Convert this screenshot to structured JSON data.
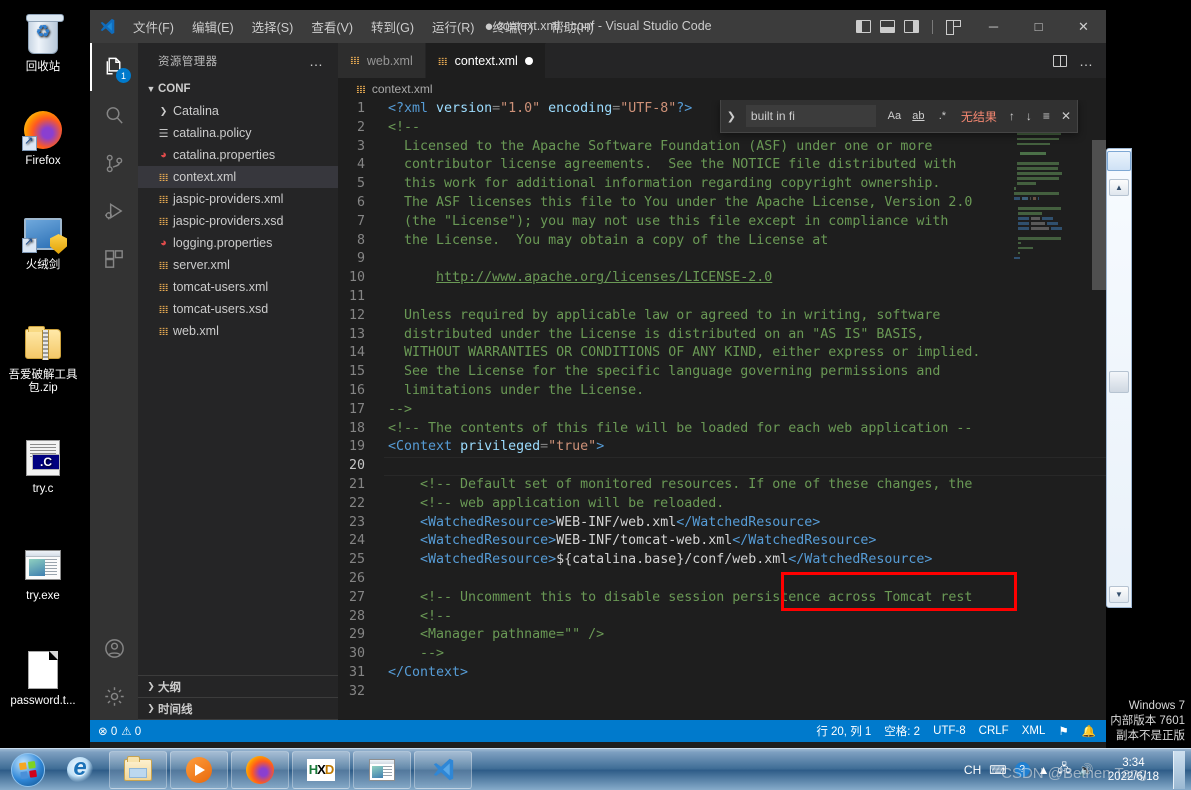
{
  "desktop": {
    "icons": [
      {
        "name": "recycle-bin",
        "label": "回收站",
        "glyph": "trash"
      },
      {
        "name": "firefox",
        "label": "Firefox",
        "glyph": "firefox"
      },
      {
        "name": "huorongjian",
        "label": "火绒剑",
        "glyph": "shield"
      },
      {
        "name": "wuaipojie-zip",
        "label": "吾爱破解工具包.zip",
        "glyph": "zip"
      },
      {
        "name": "try-c",
        "label": "try.c",
        "glyph": "csource"
      },
      {
        "name": "try-exe",
        "label": "try.exe",
        "glyph": "exe"
      },
      {
        "name": "password-txt",
        "label": "password.t... ",
        "glyph": "textfile"
      }
    ]
  },
  "vscode": {
    "titlebar": {
      "menus": [
        "文件(F)",
        "编辑(E)",
        "选择(S)",
        "查看(V)",
        "转到(G)",
        "运行(R)",
        "终端(T)",
        "帮助(H)"
      ],
      "dirty_marker": "●",
      "title": "context.xml - conf - Visual Studio Code",
      "window_controls": {
        "minimize": "─",
        "maximize": "□",
        "close": "✕"
      }
    },
    "activitybar": [
      {
        "name": "explorer",
        "icon": "files-icon",
        "badge": "1",
        "active": true
      },
      {
        "name": "search",
        "icon": "search-icon",
        "badge": "",
        "active": false
      },
      {
        "name": "source-control",
        "icon": "source-control-icon",
        "badge": "",
        "active": false
      },
      {
        "name": "run-debug",
        "icon": "run-and-debug-icon",
        "badge": "",
        "active": false
      },
      {
        "name": "extensions",
        "icon": "extensions-icon",
        "badge": "",
        "active": false
      },
      {
        "name": "accounts",
        "icon": "account-icon",
        "badge": "",
        "active": false
      },
      {
        "name": "manage",
        "icon": "gear-icon",
        "badge": "",
        "active": false
      }
    ],
    "sidebar": {
      "header": "资源管理器",
      "more": "…",
      "folder": "CONF",
      "files": [
        {
          "label": "Catalina",
          "icon": "folder",
          "selected": false
        },
        {
          "label": "catalina.policy",
          "icon": "policy",
          "selected": false
        },
        {
          "label": "catalina.properties",
          "icon": "properties",
          "selected": false
        },
        {
          "label": "context.xml",
          "icon": "xml",
          "selected": true
        },
        {
          "label": "jaspic-providers.xml",
          "icon": "xml",
          "selected": false
        },
        {
          "label": "jaspic-providers.xsd",
          "icon": "xml",
          "selected": false
        },
        {
          "label": "logging.properties",
          "icon": "properties",
          "selected": false
        },
        {
          "label": "server.xml",
          "icon": "xml",
          "selected": false
        },
        {
          "label": "tomcat-users.xml",
          "icon": "xml",
          "selected": false
        },
        {
          "label": "tomcat-users.xsd",
          "icon": "xml",
          "selected": false
        },
        {
          "label": "web.xml",
          "icon": "xml",
          "selected": false
        }
      ],
      "bottom_sections": [
        "大纲",
        "时间线"
      ]
    },
    "tabs": [
      {
        "label": "web.xml",
        "active": false,
        "dirty": false
      },
      {
        "label": "context.xml",
        "active": true,
        "dirty": true
      }
    ],
    "breadcrumb": "context.xml",
    "find": {
      "value": "built in fi",
      "match_case": "Aa",
      "whole_word": "ab",
      "regex": ".*",
      "result": "无结果",
      "prev": "↑",
      "next": "↓",
      "find_in_selection": "≡",
      "close": "✕"
    },
    "statusbar": {
      "left": [
        "⊗ 0",
        "⚠ 0"
      ],
      "position": "行 20, 列 1",
      "indent": "空格: 2",
      "encoding": "UTF-8",
      "eol": "CRLF",
      "language": "XML",
      "feedback": "⚑",
      "bell": "ὑ4"
    },
    "editor": {
      "total_lines": 32,
      "current_line": 20,
      "lines": [
        {
          "n": 1,
          "tokens": [
            {
              "t": "<?xml ",
              "c": "c-tag"
            },
            {
              "t": "version",
              "c": "c-attr"
            },
            {
              "t": "=",
              "c": "c-punc"
            },
            {
              "t": "\"1.0\"",
              "c": "c-str"
            },
            {
              "t": " ",
              "c": "c-white"
            },
            {
              "t": "encoding",
              "c": "c-attr"
            },
            {
              "t": "=",
              "c": "c-punc"
            },
            {
              "t": "\"UTF-8\"",
              "c": "c-str"
            },
            {
              "t": "?>",
              "c": "c-tag"
            }
          ]
        },
        {
          "n": 2,
          "tokens": [
            {
              "t": "<!--",
              "c": "c-com"
            }
          ]
        },
        {
          "n": 3,
          "tokens": [
            {
              "t": "  Licensed to the Apache Software Foundation (ASF) under one or more",
              "c": "c-com"
            }
          ]
        },
        {
          "n": 4,
          "tokens": [
            {
              "t": "  contributor license agreements.  See the NOTICE file distributed with",
              "c": "c-com"
            }
          ]
        },
        {
          "n": 5,
          "tokens": [
            {
              "t": "  this work for additional information regarding copyright ownership.",
              "c": "c-com"
            }
          ]
        },
        {
          "n": 6,
          "tokens": [
            {
              "t": "  The ASF licenses this file to You under the Apache License, Version 2.0",
              "c": "c-com"
            }
          ]
        },
        {
          "n": 7,
          "tokens": [
            {
              "t": "  (the \"License\"); you may not use this file except in compliance with",
              "c": "c-com"
            }
          ]
        },
        {
          "n": 8,
          "tokens": [
            {
              "t": "  the License.  You may obtain a copy of the License at",
              "c": "c-com"
            }
          ]
        },
        {
          "n": 9,
          "tokens": [
            {
              "t": "",
              "c": "c-com"
            }
          ]
        },
        {
          "n": 10,
          "tokens": [
            {
              "t": "      ",
              "c": "c-com"
            },
            {
              "t": "http://www.apache.org/licenses/LICENSE-2.0",
              "c": "c-link"
            }
          ]
        },
        {
          "n": 11,
          "tokens": [
            {
              "t": "",
              "c": "c-com"
            }
          ]
        },
        {
          "n": 12,
          "tokens": [
            {
              "t": "  Unless required by applicable law or agreed to in writing, software",
              "c": "c-com"
            }
          ]
        },
        {
          "n": 13,
          "tokens": [
            {
              "t": "  distributed under the License is distributed on an \"AS IS\" BASIS,",
              "c": "c-com"
            }
          ]
        },
        {
          "n": 14,
          "tokens": [
            {
              "t": "  WITHOUT WARRANTIES OR CONDITIONS OF ANY KIND, either express or implied.",
              "c": "c-com"
            }
          ]
        },
        {
          "n": 15,
          "tokens": [
            {
              "t": "  See the License for the specific language governing permissions and",
              "c": "c-com"
            }
          ]
        },
        {
          "n": 16,
          "tokens": [
            {
              "t": "  limitations under the License.",
              "c": "c-com"
            }
          ]
        },
        {
          "n": 17,
          "tokens": [
            {
              "t": "-->",
              "c": "c-com"
            }
          ]
        },
        {
          "n": 18,
          "tokens": [
            {
              "t": "<!-- The contents of this file will be loaded for each web application --",
              "c": "c-com"
            }
          ]
        },
        {
          "n": 19,
          "tokens": [
            {
              "t": "<Context ",
              "c": "c-tag"
            },
            {
              "t": "privileged",
              "c": "c-attr"
            },
            {
              "t": "=",
              "c": "c-punc"
            },
            {
              "t": "\"true\"",
              "c": "c-str"
            },
            {
              "t": ">",
              "c": "c-tag"
            }
          ]
        },
        {
          "n": 20,
          "tokens": [
            {
              "t": "",
              "c": "c-white"
            }
          ]
        },
        {
          "n": 21,
          "tokens": [
            {
              "t": "    <!-- Default set of monitored resources. If one of these changes, the",
              "c": "c-com"
            }
          ]
        },
        {
          "n": 22,
          "tokens": [
            {
              "t": "    <!-- web application will be reloaded.",
              "c": "c-com"
            }
          ]
        },
        {
          "n": 23,
          "tokens": [
            {
              "t": "    <WatchedResource>",
              "c": "c-tag"
            },
            {
              "t": "WEB-INF/web.xml",
              "c": "c-white"
            },
            {
              "t": "</WatchedResource>",
              "c": "c-tag"
            }
          ]
        },
        {
          "n": 24,
          "tokens": [
            {
              "t": "    <WatchedResource>",
              "c": "c-tag"
            },
            {
              "t": "WEB-INF/tomcat-web.xml",
              "c": "c-white"
            },
            {
              "t": "</WatchedResource>",
              "c": "c-tag"
            }
          ]
        },
        {
          "n": 25,
          "tokens": [
            {
              "t": "    <WatchedResource>",
              "c": "c-tag"
            },
            {
              "t": "${catalina.base}/conf/web.xml",
              "c": "c-white"
            },
            {
              "t": "</WatchedResource>",
              "c": "c-tag"
            }
          ]
        },
        {
          "n": 26,
          "tokens": [
            {
              "t": "",
              "c": "c-white"
            }
          ]
        },
        {
          "n": 27,
          "tokens": [
            {
              "t": "    <!-- Uncomment this to disable session persistence across Tomcat rest",
              "c": "c-com"
            }
          ]
        },
        {
          "n": 28,
          "tokens": [
            {
              "t": "    <!--",
              "c": "c-com"
            }
          ]
        },
        {
          "n": 29,
          "tokens": [
            {
              "t": "    <Manager pathname=\"\" />",
              "c": "c-com"
            }
          ]
        },
        {
          "n": 30,
          "tokens": [
            {
              "t": "    -->",
              "c": "c-com"
            }
          ]
        },
        {
          "n": 31,
          "tokens": [
            {
              "t": "</Context>",
              "c": "c-tag"
            }
          ]
        },
        {
          "n": 32,
          "tokens": [
            {
              "t": "",
              "c": "c-white"
            }
          ]
        }
      ]
    },
    "annotation": {
      "name": "red-highlight-box",
      "color": "#ff0000"
    }
  },
  "watermark": {
    "line1": "Windows 7",
    "line2": "内部版本 7601",
    "line3": "副本不是正版"
  },
  "taskbar": {
    "start": "start-orb",
    "buttons": [
      {
        "name": "internet-explorer",
        "glyph": "ie"
      },
      {
        "name": "windows-explorer",
        "glyph": "folder"
      },
      {
        "name": "windows-media-player",
        "glyph": "wmp"
      },
      {
        "name": "firefox",
        "glyph": "firefox"
      },
      {
        "name": "hxd-hex-editor",
        "glyph": "hxd"
      },
      {
        "name": "application",
        "glyph": "app"
      },
      {
        "name": "visual-studio-code",
        "glyph": "vscode"
      }
    ],
    "tray": {
      "ime": "CH",
      "keyboard": "keyboard-icon",
      "help": "?",
      "expand": "▲"
    },
    "clock": {
      "time": "3:34",
      "date": "2022/6/18"
    },
    "overlay_text": "CSDN @Bethen Tang"
  }
}
